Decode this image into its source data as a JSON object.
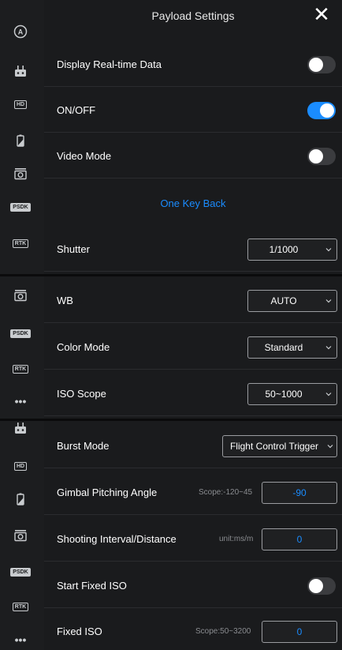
{
  "header": {
    "title": "Payload Settings"
  },
  "sidebar": {
    "items": [
      {
        "icon": "autopilot-icon"
      },
      {
        "icon": "remote-controller-icon"
      },
      {
        "icon": "hd-icon",
        "label": "HD"
      },
      {
        "icon": "battery-icon"
      },
      {
        "icon": "camera-icon"
      },
      {
        "icon": "psdk-icon",
        "label": "PSDK"
      },
      {
        "icon": "rtk-icon",
        "label": "RTK"
      },
      {
        "icon": "more-icon",
        "label": "•••"
      }
    ]
  },
  "settings": {
    "display_realtime": {
      "label": "Display Real-time Data",
      "state": "off"
    },
    "on_off": {
      "label": "ON/OFF",
      "state": "on"
    },
    "video_mode": {
      "label": "Video Mode",
      "state": "off"
    },
    "one_key_back": {
      "label": "One Key Back"
    },
    "shutter": {
      "label": "Shutter",
      "value": "1/1000"
    },
    "wb": {
      "label": "WB",
      "value": "AUTO"
    },
    "color_mode": {
      "label": "Color Mode",
      "value": "Standard"
    },
    "iso_scope": {
      "label": "ISO Scope",
      "value": "50~1000"
    },
    "burst_mode": {
      "label": "Burst Mode",
      "value": "Flight Control Trigger"
    },
    "gimbal_pitch": {
      "label": "Gimbal Pitching Angle",
      "hint": "Scope:-120~45",
      "value": "-90"
    },
    "interval": {
      "label": "Shooting Interval/Distance",
      "hint": "unit:ms/m",
      "value": "0"
    },
    "start_fixed_iso": {
      "label": "Start Fixed ISO",
      "state": "off"
    },
    "fixed_iso": {
      "label": "Fixed ISO",
      "hint": "Scope:50~3200",
      "value": "0"
    }
  },
  "colors": {
    "accent": "#1a8cff",
    "panel": "#1a1b1d",
    "sidebar": "#1c1d1f"
  }
}
